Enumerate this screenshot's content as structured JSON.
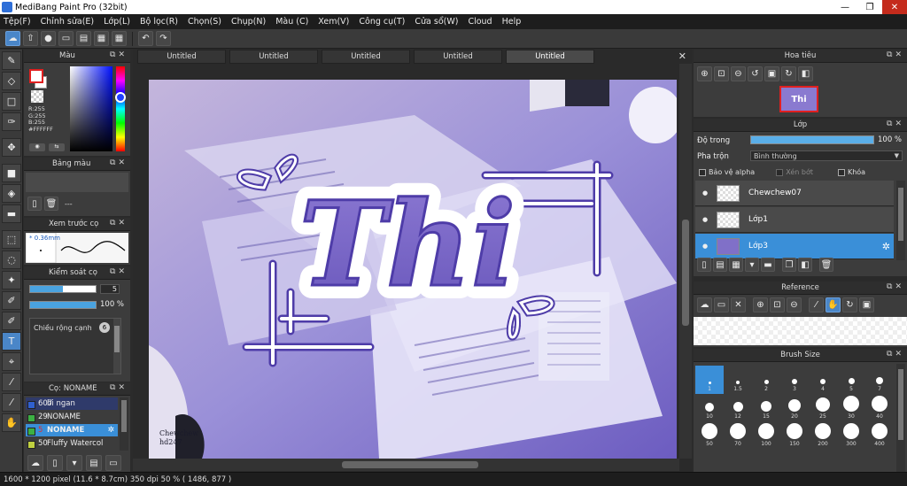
{
  "window": {
    "title": "MediBang Paint Pro (32bit)"
  },
  "menu": [
    "Tệp(F)",
    "Chỉnh sửa(E)",
    "Lớp(L)",
    "Bộ lọc(R)",
    "Chọn(S)",
    "Chụp(N)",
    "Màu (C)",
    "Xem(V)",
    "Công cụ(T)",
    "Cửa sổ(W)",
    "Cloud",
    "Help"
  ],
  "left_panels": {
    "color": {
      "title": "Màu",
      "r": "R:255",
      "g": "G:255",
      "b": "B:255",
      "hex": "#FFFFFF"
    },
    "palette": {
      "title": "Bảng màu",
      "name": "---"
    },
    "brush_preview": {
      "title": "Xem trước cọ",
      "size": "0.36mm"
    },
    "brush_control": {
      "title": "Kiểm soát cọ",
      "size_value": "5",
      "opacity_value": "100 %",
      "opacity_fraction": 1.0,
      "size_fraction": 0.5,
      "width_label": "Chiều rộng cạnh",
      "width_value": "6"
    },
    "brush_list": {
      "title": "Cọ: NONAME",
      "items": [
        {
          "num": "607",
          "name": "bi ngan",
          "selected": false
        },
        {
          "num": "29",
          "name": "NONAME",
          "selected": false
        },
        {
          "num": "5",
          "name": "NONAME",
          "selected": true
        },
        {
          "num": "50",
          "name": "Fluffy Watercol",
          "selected": false
        }
      ]
    }
  },
  "tabs": [
    "Untitled",
    "Untitled",
    "Untitled",
    "Untitled",
    "Untitled"
  ],
  "active_tab": 4,
  "canvas": {
    "lettering": "Thi",
    "signature": "Chewchew\nhd247"
  },
  "right_panels": {
    "navigator": {
      "title": "Hoa tiêu",
      "thumb_text": "Thi"
    },
    "layer": {
      "title": "Lớp",
      "opacity_label": "Độ trong",
      "opacity_value": "100 %",
      "blend_label": "Pha trộn",
      "blend_value": "Bình thường",
      "protect_alpha": "Bảo vệ alpha",
      "clipping": "Xén bớt",
      "lock": "Khóa",
      "layers": [
        {
          "name": "Chewchew07",
          "selected": false
        },
        {
          "name": "Lớp1",
          "selected": false
        },
        {
          "name": "Lớp3",
          "selected": true
        }
      ]
    },
    "reference": {
      "title": "Reference"
    },
    "brush_size": {
      "title": "Brush Size",
      "sizes": [
        "1",
        "1.5",
        "2",
        "3",
        "4",
        "5",
        "7",
        "10",
        "12",
        "15",
        "20",
        "25",
        "30",
        "40",
        "50",
        "70",
        "100",
        "150",
        "200",
        "300",
        "400"
      ],
      "selected": "1"
    }
  },
  "status": {
    "text": "1600 * 1200 pixel   (11.6 * 8.7cm)   350 dpi   50 %   ( 1486, 877 )"
  },
  "colors": {
    "accent": "#3a8fd8",
    "panel": "#3c3c3c",
    "lettering": "#7a68c8"
  }
}
